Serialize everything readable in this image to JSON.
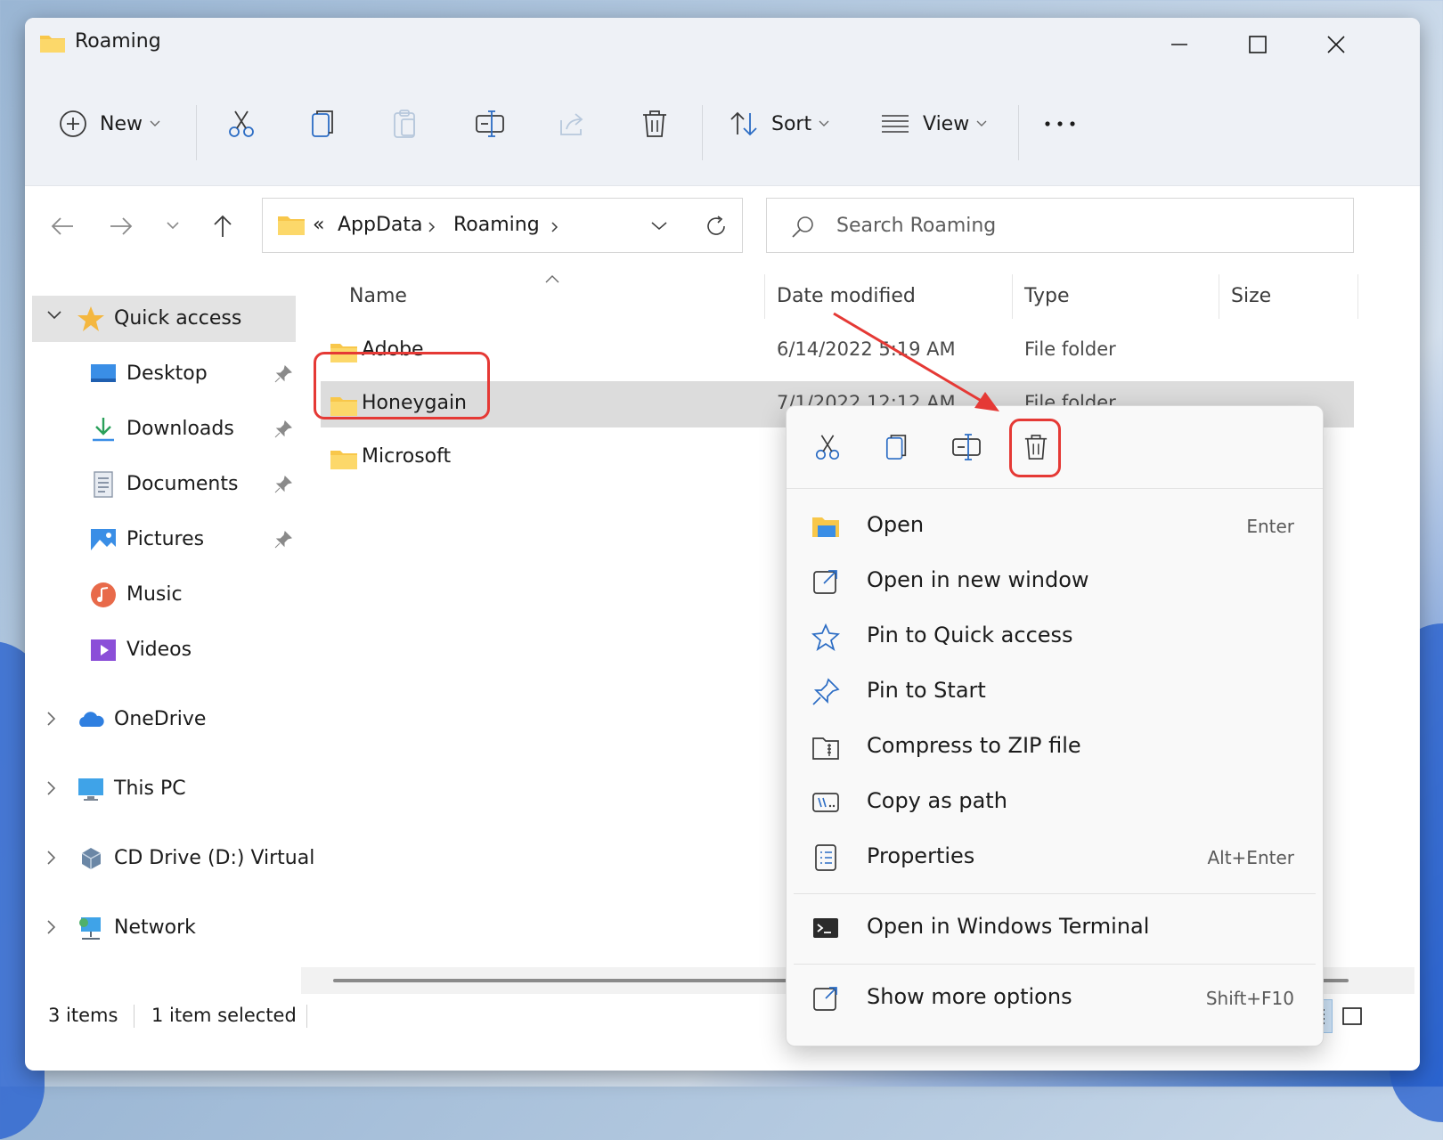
{
  "window": {
    "title": "Roaming"
  },
  "toolbar": {
    "new_label": "New",
    "sort_label": "Sort",
    "view_label": "View"
  },
  "address": {
    "overflow": "«",
    "segments": [
      "AppData",
      "Roaming"
    ]
  },
  "search": {
    "placeholder": "Search Roaming"
  },
  "sidebar": {
    "quick_access": "Quick access",
    "items": [
      {
        "label": "Desktop",
        "icon": "desktop-icon",
        "pinned": true
      },
      {
        "label": "Downloads",
        "icon": "downloads-icon",
        "pinned": true
      },
      {
        "label": "Documents",
        "icon": "documents-icon",
        "pinned": true
      },
      {
        "label": "Pictures",
        "icon": "pictures-icon",
        "pinned": true
      },
      {
        "label": "Music",
        "icon": "music-icon",
        "pinned": false
      },
      {
        "label": "Videos",
        "icon": "videos-icon",
        "pinned": false
      }
    ],
    "roots": [
      {
        "label": "OneDrive",
        "icon": "onedrive-icon"
      },
      {
        "label": "This PC",
        "icon": "this-pc-icon"
      },
      {
        "label": "CD Drive (D:) Virtual",
        "icon": "cd-drive-icon"
      },
      {
        "label": "Network",
        "icon": "network-icon"
      }
    ]
  },
  "columns": {
    "name": "Name",
    "date": "Date modified",
    "type": "Type",
    "size": "Size"
  },
  "files": [
    {
      "name": "Adobe",
      "date": "6/14/2022 5:19 AM",
      "type": "File folder",
      "selected": false
    },
    {
      "name": "Honeygain",
      "date": "7/1/2022 12:12 AM",
      "type": "File folder",
      "selected": true
    },
    {
      "name": "Microsoft",
      "date": "",
      "type": "",
      "selected": false
    }
  ],
  "status": {
    "count": "3 items",
    "selection": "1 item selected"
  },
  "context_menu": {
    "items": [
      {
        "label": "Open",
        "shortcut": "Enter",
        "icon": "open-folder-icon"
      },
      {
        "label": "Open in new window",
        "shortcut": "",
        "icon": "new-window-icon"
      },
      {
        "label": "Pin to Quick access",
        "shortcut": "",
        "icon": "star-icon"
      },
      {
        "label": "Pin to Start",
        "shortcut": "",
        "icon": "pin-icon"
      },
      {
        "label": "Compress to ZIP file",
        "shortcut": "",
        "icon": "zip-icon"
      },
      {
        "label": "Copy as path",
        "shortcut": "",
        "icon": "copy-path-icon"
      },
      {
        "label": "Properties",
        "shortcut": "Alt+Enter",
        "icon": "properties-icon"
      }
    ],
    "terminal": {
      "label": "Open in Windows Terminal",
      "icon": "terminal-icon"
    },
    "more": {
      "label": "Show more options",
      "shortcut": "Shift+F10",
      "icon": "more-options-icon"
    }
  },
  "colors": {
    "accent": "#0067c0",
    "annotation": "#e53935",
    "folder": "#f8c74a"
  }
}
